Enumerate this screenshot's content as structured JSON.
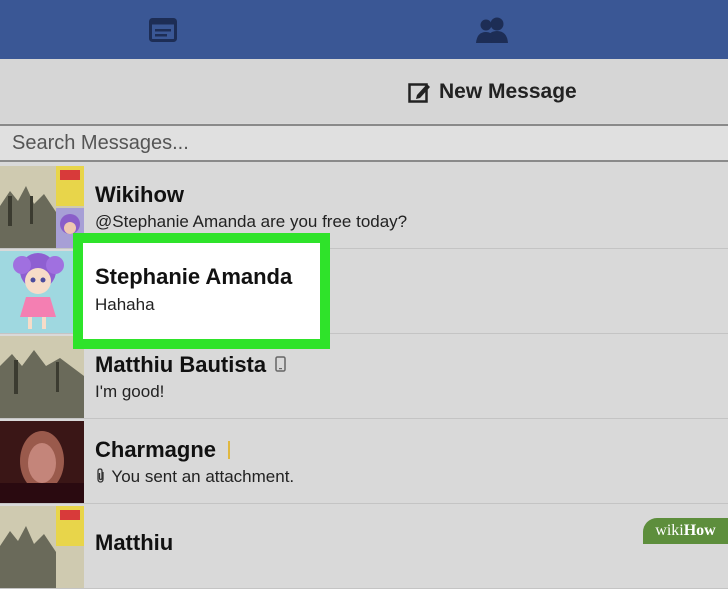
{
  "topbar": {
    "tabs": [
      {
        "icon": "news-feed-icon"
      },
      {
        "icon": "friends-icon"
      }
    ]
  },
  "toolbar": {
    "new_message_label": "New Message",
    "new_message_icon": "compose-icon"
  },
  "search": {
    "placeholder": "Search Messages..."
  },
  "conversations": [
    {
      "name": "Wikihow",
      "preview": "@Stephanie Amanda are you free today?"
    },
    {
      "name": "Stephanie Amanda",
      "preview": "Hahaha"
    },
    {
      "name": "Matthiu Bautista",
      "preview": "I'm good!",
      "status_icon": "mobile-icon"
    },
    {
      "name": "Charmagne",
      "preview": "You sent an attachment.",
      "preview_icon": "paperclip-icon"
    },
    {
      "name": "Matthiu",
      "preview": ""
    }
  ],
  "watermark": {
    "prefix": "wiki",
    "suffix": "How"
  },
  "colors": {
    "topbar": "#3a5795",
    "highlight": "#2fe32a",
    "background": "#d9d9d9"
  }
}
